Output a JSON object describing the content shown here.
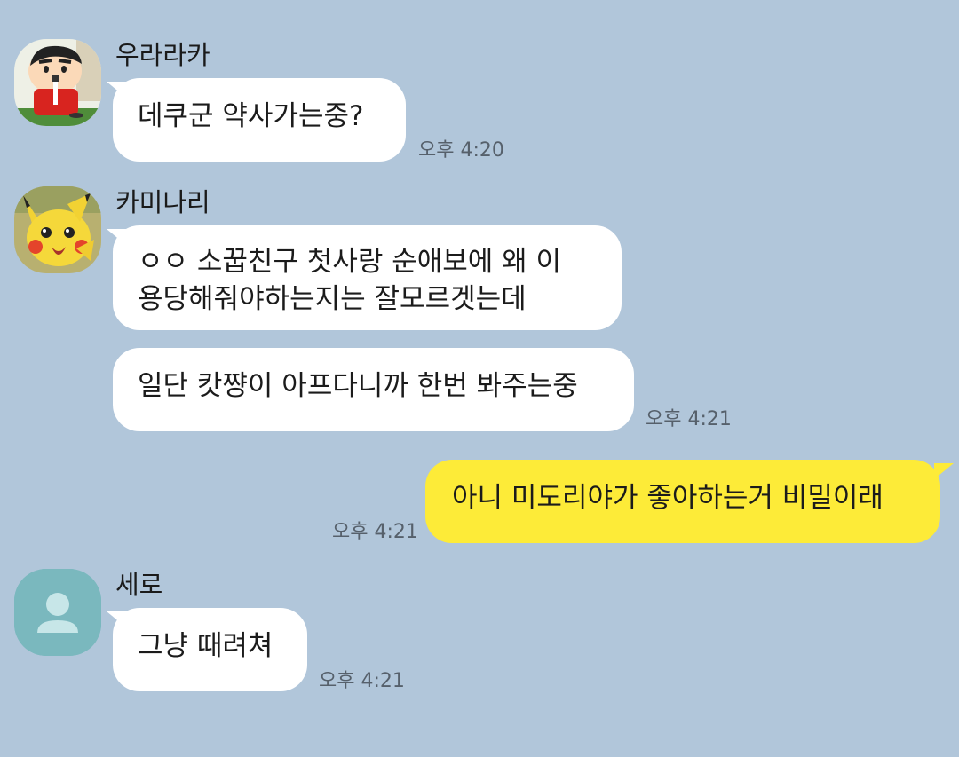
{
  "colors": {
    "background": "#b1c6da",
    "incoming_bubble": "#ffffff",
    "outgoing_bubble": "#fdeb38",
    "default_avatar": "#7ab8be"
  },
  "messages": {
    "m1": {
      "sender": "우라라카",
      "avatar_icon": "crayon-shinchan-avatar-icon",
      "text": "데쿠군 약사가는중?",
      "time": "오후 4:20"
    },
    "m2": {
      "sender": "카미나리",
      "avatar_icon": "pikachu-avatar-icon",
      "line1": "ㅇㅇ 소꿉친구 첫사랑 순애보에 왜 이",
      "line2": "용당해줘야하는지는 잘모르겟는데",
      "text2": "일단 캇쨩이 아프다니까 한번 봐주는중",
      "time": "오후 4:21"
    },
    "m3": {
      "text": "아니 미도리야가 좋아하는거 비밀이래",
      "time": "오후 4:21"
    },
    "m4": {
      "sender": "세로",
      "avatar_icon": "default-person-avatar-icon",
      "text": "그냥 때려쳐",
      "time": "오후 4:21"
    }
  }
}
